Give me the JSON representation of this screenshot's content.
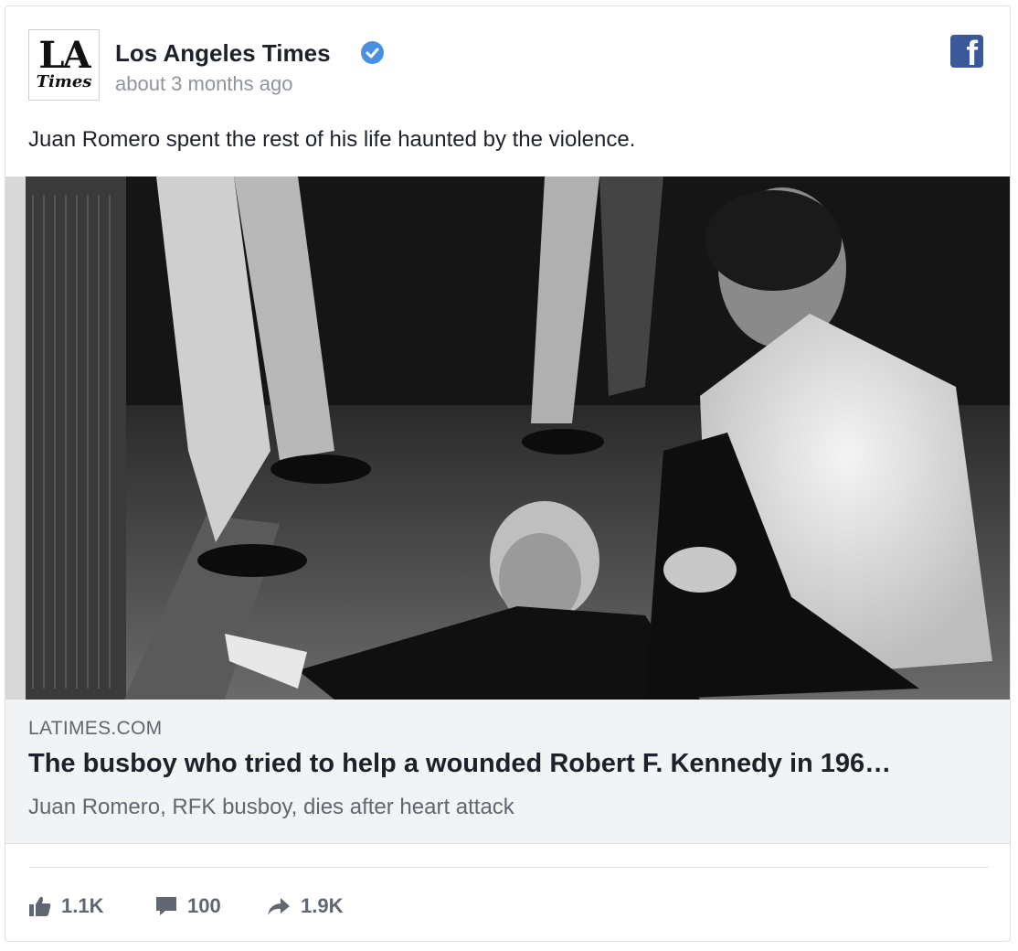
{
  "post": {
    "page_name": "Los Angeles Times",
    "timestamp": "about 3 months ago",
    "text": "Juan Romero spent the rest of his life haunted by the violence.",
    "logo": {
      "line1": "LA",
      "line2": "Times"
    }
  },
  "link": {
    "domain": "LATIMES.COM",
    "headline": "The busboy who tried to help a wounded Robert F. Kennedy in 196…",
    "subtitle": "Juan Romero, RFK busboy, dies after heart attack"
  },
  "stats": {
    "likes": "1.1K",
    "comments": "100",
    "shares": "1.9K"
  },
  "icons": {
    "verified": "verified-badge-icon",
    "facebook": "facebook-icon",
    "like": "thumbs-up-icon",
    "comment": "comment-icon",
    "share": "share-arrow-icon"
  },
  "colors": {
    "verified_blue": "#4a90e2",
    "facebook_blue": "#3b5998",
    "text_primary": "#1d2129",
    "text_secondary": "#90949c",
    "link_bg": "#f2f3f5"
  }
}
